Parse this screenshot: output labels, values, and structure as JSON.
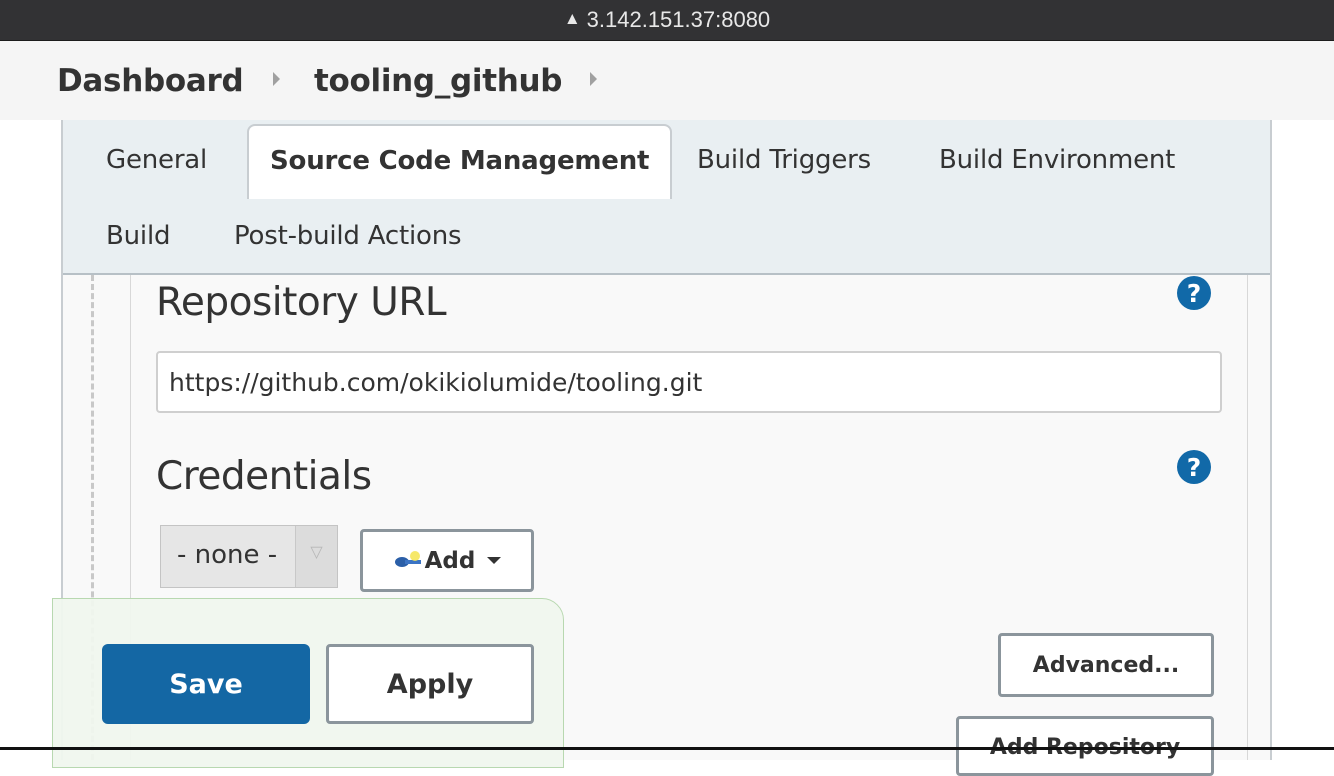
{
  "browser": {
    "address": "3.142.151.37:8080",
    "warning_icon": "warning-triangle-icon"
  },
  "breadcrumb": {
    "items": [
      "Dashboard",
      "tooling_github"
    ]
  },
  "tabs": [
    {
      "label": "General",
      "active": false
    },
    {
      "label": "Source Code Management",
      "active": true
    },
    {
      "label": "Build Triggers",
      "active": false
    },
    {
      "label": "Build Environment",
      "active": false
    },
    {
      "label": "Build",
      "active": false
    },
    {
      "label": "Post-build Actions",
      "active": false
    }
  ],
  "scm": {
    "repository_url_label": "Repository URL",
    "repository_url_value": "https://github.com/okikiolumide/tooling.git",
    "credentials_label": "Credentials",
    "credentials_selected": "- none -",
    "add_label": "Add",
    "help_glyph": "?",
    "advanced_label": "Advanced...",
    "add_repository_label": "Add Repository"
  },
  "actions": {
    "save_label": "Save",
    "apply_label": "Apply"
  },
  "colors": {
    "primary": "#1467a4",
    "help": "#1169a8",
    "tabbar": "#e9eff2"
  }
}
